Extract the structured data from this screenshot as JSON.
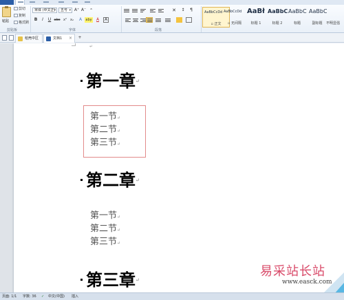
{
  "ribbon": {
    "clipboard": {
      "paste": "粘贴",
      "cut": "剪切",
      "copy": "复制",
      "format_painter": "格式刷",
      "group_label": "剪贴板"
    },
    "font": {
      "font_name": "宋体 (中文正)",
      "font_size": "五号",
      "grow": "A⁺",
      "shrink": "A⁻",
      "clear": "ᵃ",
      "bold": "B",
      "italic": "I",
      "underline": "U",
      "strike": "abc",
      "superscript": "x²",
      "subscript": "x₂",
      "effects": "A",
      "highlight": "aby",
      "font_color": "A",
      "char_border": "A",
      "group_label": "字体"
    },
    "paragraph": {
      "group_label": "段落"
    },
    "styles": {
      "items": [
        {
          "sample": "AaBbCcDd",
          "name": "▫ 正文"
        },
        {
          "sample": "AaBbCcDd",
          "name": "▫ 无间隔"
        },
        {
          "sample": "AaBł",
          "name": "标题 1"
        },
        {
          "sample": "AaBbC",
          "name": "标题 2"
        },
        {
          "sample": "AaBbC",
          "name": "标题"
        },
        {
          "sample": "AaBbC",
          "name": "副标题"
        },
        {
          "sample": "",
          "name": "不明显强"
        }
      ]
    }
  },
  "tabs": [
    {
      "label": "稻壳中区"
    },
    {
      "label": "文档1"
    }
  ],
  "new_tab": "+",
  "tab_close": "×",
  "document": {
    "chapters": [
      {
        "title": "第一章"
      },
      {
        "title": "第二章"
      },
      {
        "title": "第三章"
      }
    ],
    "sections_group_1": [
      "第一节",
      "第二节",
      "第三节"
    ],
    "sections_group_2": [
      "第一节",
      "第二节",
      "第三节"
    ],
    "paragraph_mark": "↵"
  },
  "status": {
    "page": "页面: 1/1",
    "words": "字数: 36",
    "language": "中文(中国)",
    "mode": "插入"
  },
  "watermark": {
    "name": "易采站长站",
    "url": "www.easck.com"
  },
  "colors": {
    "ribbon_blue": "#2b5ea7",
    "selection_box": "#e28a8a",
    "watermark_red": "#d94b6a"
  }
}
